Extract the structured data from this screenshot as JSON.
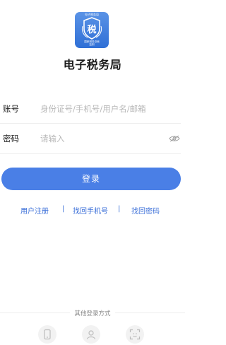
{
  "logo": {
    "top_text": "电子税务局",
    "char": "税",
    "bottom_text": "国家税务总局\n监制",
    "icon": "tax-bureau-logo-icon"
  },
  "app_title": "电子税务局",
  "form": {
    "account_label": "账号",
    "account_placeholder": "身份证号/手机号/用户名/邮箱",
    "password_label": "密码",
    "password_placeholder": "请输入",
    "eye_icon": "eye-hidden-icon"
  },
  "login_button": "登录",
  "links": {
    "register": "用户注册",
    "separator": "|",
    "find_phone": "找回手机号",
    "find_password": "找回密码"
  },
  "other_login": {
    "title": "其他登录方式",
    "options": [
      "phone-icon",
      "face-recognition-icon",
      "face-scan-icon"
    ]
  },
  "colors": {
    "primary": "#4a7fe6",
    "link": "#3b6fd8",
    "placeholder": "#b8b8b8"
  }
}
